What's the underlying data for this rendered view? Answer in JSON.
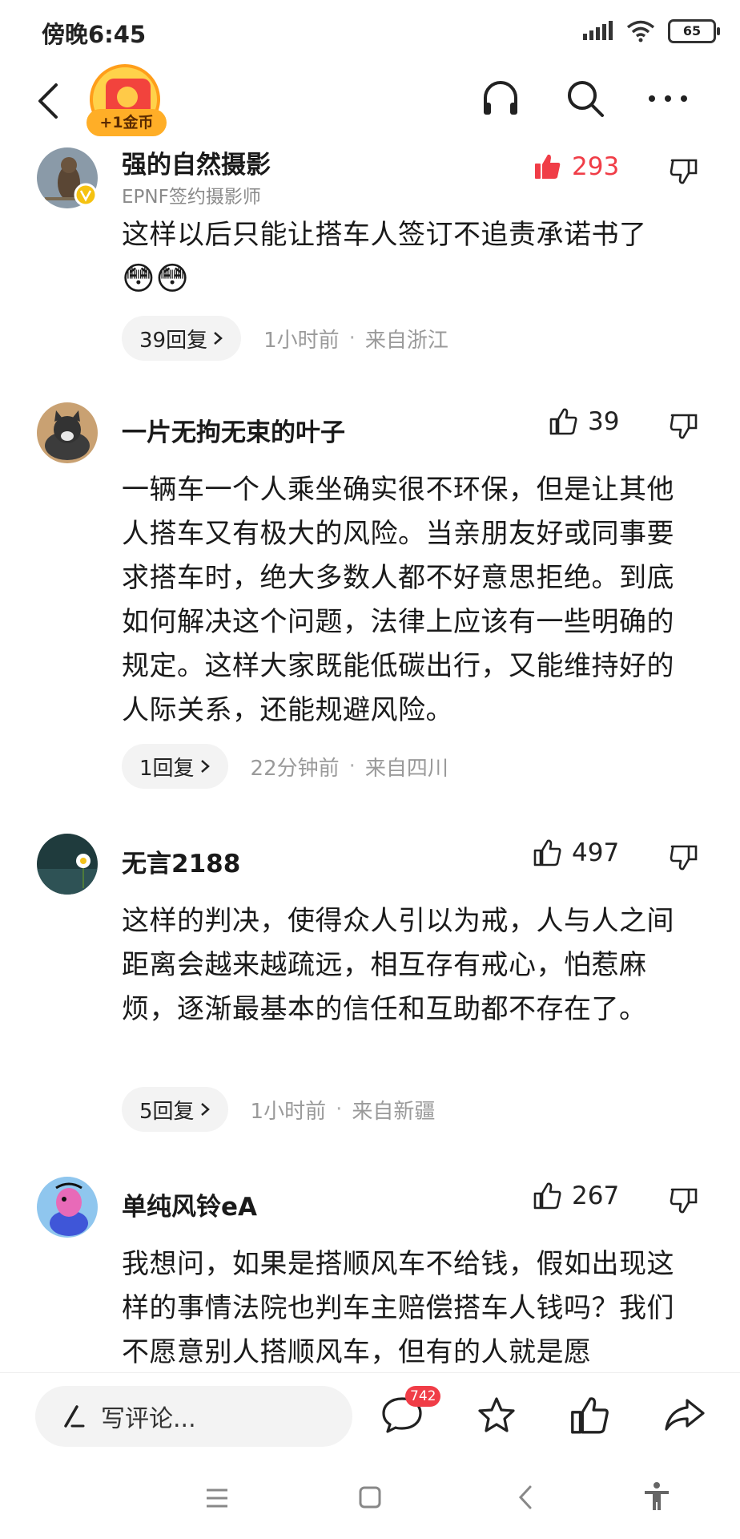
{
  "status_bar": {
    "time": "傍晚6:45",
    "battery": "65"
  },
  "header": {
    "coin_label": "+1金币"
  },
  "comments": [
    {
      "username": "强的自然摄影",
      "subtitle": "EPNF签约摄影师",
      "likes": "293",
      "liked": true,
      "content": "这样以后只能让搭车人签订不追责承诺书了",
      "emoji": "😳😳",
      "replies": "39回复",
      "time": "1小时前",
      "location": "来自浙江"
    },
    {
      "username": "一片无拘无束的叶子",
      "likes": "39",
      "liked": false,
      "content": "一辆车一个人乘坐确实很不环保，但是让其他人搭车又有极大的风险。当亲朋友好或同事要求搭车时，绝大多数人都不好意思拒绝。到底如何解决这个问题，法律上应该有一些明确的规定。这样大家既能低碳出行，又能维持好的人际关系，还能规避风险。",
      "replies": "1回复",
      "time": "22分钟前",
      "location": "来自四川"
    },
    {
      "username": "无言2188",
      "likes": "497",
      "liked": false,
      "content": "这样的判决，使得众人引以为戒，人与人之间距离会越来越疏远，相互存有戒心，怕惹麻烦，逐渐最基本的信任和互助都不存在了。",
      "replies": "5回复",
      "time": "1小时前",
      "location": "来自新疆"
    },
    {
      "username": "单纯风铃eA",
      "likes": "267",
      "liked": false,
      "content": "我想问，如果是搭顺风车不给钱，假如出现这样的事情法院也判车主赔偿搭车人钱吗？我们不愿意别人搭顺风车，但有的人就是愿"
    }
  ],
  "bottom_bar": {
    "input_placeholder": "写评论...",
    "comment_count": "742"
  },
  "colors": {
    "accent_red": "#f03d47",
    "coin_orange": "#ffae27"
  }
}
